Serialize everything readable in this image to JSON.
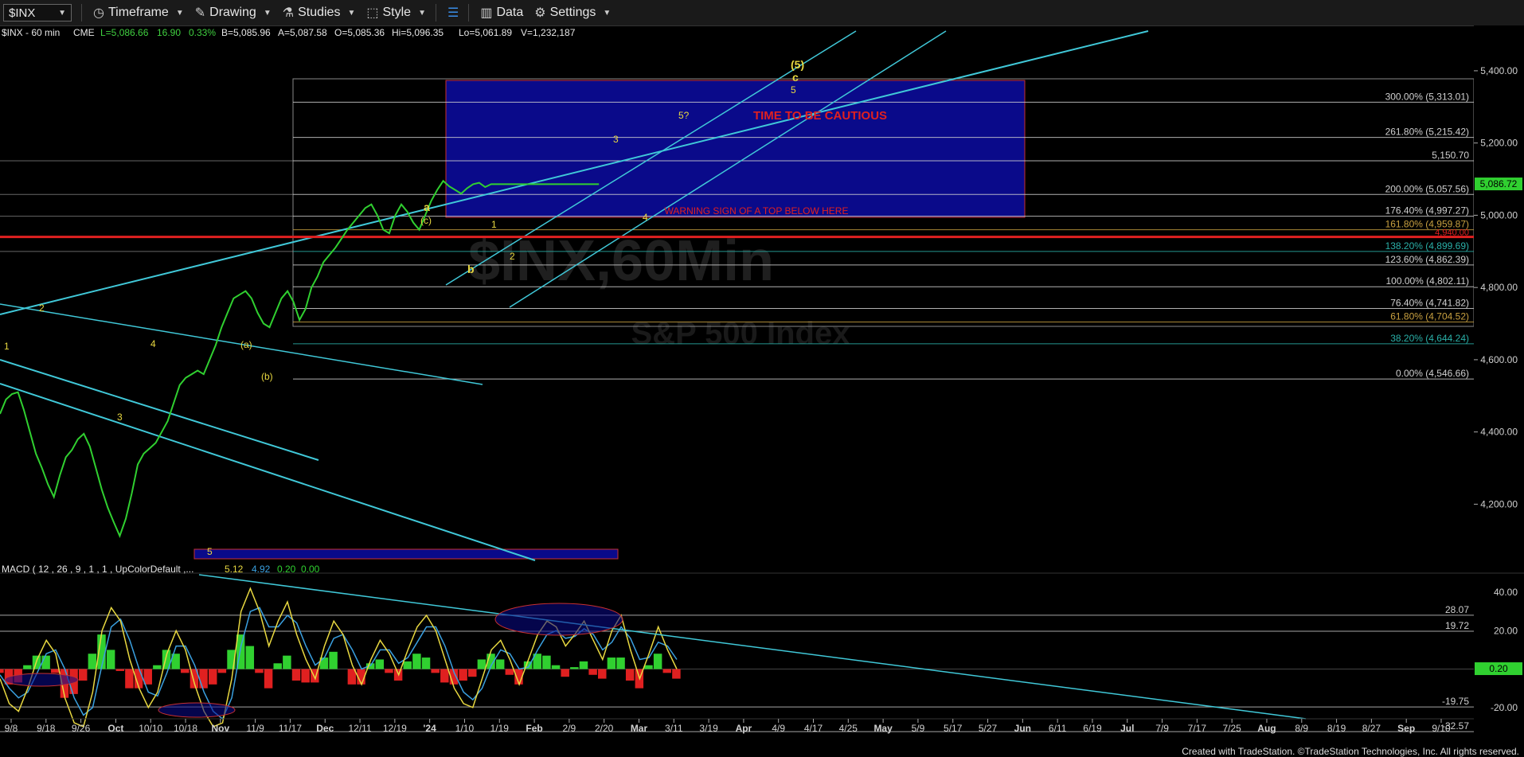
{
  "toolbar": {
    "symbol": "$INX",
    "items": [
      {
        "label": "Timeframe",
        "icon": "clock-icon"
      },
      {
        "label": "Drawing",
        "icon": "pencil-icon"
      },
      {
        "label": "Studies",
        "icon": "flask-icon"
      },
      {
        "label": "Style",
        "icon": "style-icon"
      },
      {
        "label": "",
        "icon": "layout-icon"
      },
      {
        "label": "Data",
        "icon": "bars-icon"
      },
      {
        "label": "Settings",
        "icon": "gear-icon"
      }
    ]
  },
  "chart_data": {
    "type": "line",
    "header": {
      "symbol": "$INX - 60 min",
      "exchange": "CME",
      "last": "L=5,086.66",
      "change": "16.90",
      "change_pct": "0.33%",
      "bid": "B=5,085.96",
      "ask": "A=5,087.58",
      "o": "O=5,085.36",
      "hi": "Hi=5,096.35",
      "lo": "Lo=5,061.89",
      "vol": "V=1,232,187"
    },
    "watermark": {
      "symbol": "$INX,60Min",
      "name": "S&P 500 Index"
    },
    "price_axis": {
      "ylim": [
        4040,
        5510
      ],
      "ticks": [
        "4,200.00",
        "4,400.00",
        "4,600.00",
        "4,800.00",
        "5,000.00",
        "5,200.00",
        "5,400.00"
      ],
      "tick_values": [
        4200,
        4400,
        4600,
        4800,
        5000,
        5200,
        5400
      ],
      "last_label": "5,086.72",
      "last_value": 5086.72
    },
    "x_axis": {
      "ticks": [
        "9/8",
        "9/18",
        "9/26",
        "Oct",
        "10/10",
        "10/18",
        "Nov",
        "11/9",
        "11/17",
        "Dec",
        "12/11",
        "12/19",
        "'24",
        "1/10",
        "1/19",
        "Feb",
        "2/9",
        "2/20",
        "Mar",
        "3/11",
        "3/19",
        "Apr",
        "4/9",
        "4/17",
        "4/25",
        "May",
        "5/9",
        "5/17",
        "5/27",
        "Jun",
        "6/11",
        "6/19",
        "Jul",
        "7/9",
        "7/17",
        "7/25",
        "Aug",
        "8/9",
        "8/19",
        "8/27",
        "Sep",
        "9/10"
      ],
      "bold": [
        "Oct",
        "Nov",
        "Dec",
        "'24",
        "Feb",
        "Mar",
        "Apr",
        "May",
        "Jun",
        "Jul",
        "Aug",
        "Sep"
      ]
    },
    "series": [
      {
        "x": [
          0,
          3,
          6,
          9,
          12,
          15,
          18,
          21,
          24,
          27,
          30,
          33,
          36,
          39,
          42,
          45,
          48,
          51,
          54,
          57,
          60,
          63,
          66,
          69,
          72,
          75,
          78,
          81,
          84,
          87,
          90,
          93,
          96,
          99,
          102,
          105,
          108,
          111,
          114,
          117,
          120,
          123,
          126,
          129,
          132,
          135,
          138,
          141,
          144,
          147,
          150,
          153,
          156,
          159,
          162,
          165,
          168,
          171,
          174,
          177,
          180,
          183,
          186,
          189,
          192,
          195,
          198,
          201,
          204,
          207,
          210,
          213,
          216,
          219,
          222,
          225,
          228,
          231,
          234,
          237,
          240,
          243,
          246,
          249,
          252,
          255,
          258,
          261,
          264,
          267,
          270,
          273,
          276,
          279,
          282,
          285,
          288,
          291,
          294,
          297,
          300,
          303,
          306,
          309,
          312,
          315,
          318,
          321,
          324,
          327,
          330,
          333,
          336,
          339
        ],
        "values": [
          4450,
          4490,
          4505,
          4510,
          4460,
          4400,
          4340,
          4300,
          4255,
          4220,
          4280,
          4330,
          4350,
          4380,
          4395,
          4360,
          4300,
          4240,
          4190,
          4150,
          4112,
          4160,
          4230,
          4310,
          4340,
          4355,
          4370,
          4400,
          4430,
          4480,
          4530,
          4550,
          4560,
          4570,
          4560,
          4600,
          4640,
          4690,
          4730,
          4770,
          4780,
          4790,
          4770,
          4730,
          4700,
          4690,
          4730,
          4770,
          4790,
          4760,
          4710,
          4740,
          4800,
          4830,
          4870,
          4890,
          4910,
          4935,
          4960,
          4980,
          5000,
          5020,
          5030,
          5000,
          4960,
          4950,
          5000,
          5030,
          5010,
          4980,
          4960,
          5000,
          5040,
          5070,
          5095,
          5080,
          5070,
          5060,
          5075,
          5086,
          5090,
          5078,
          5086,
          5086,
          5086,
          5086,
          5086,
          5086,
          5086,
          5086,
          5086,
          5086,
          5086,
          5086,
          5086,
          5086,
          5086,
          5086,
          5086,
          5086,
          5086,
          5086,
          5086,
          5086,
          5086,
          5086,
          5086,
          5086,
          5086,
          5086,
          5086,
          5086,
          5086,
          5086
        ]
      }
    ],
    "price_levels": [
      {
        "label": "300.00% (5,313.01)",
        "value": 5313.01,
        "color": "#d0d0d0"
      },
      {
        "label": "261.80% (5,215.42)",
        "value": 5215.42,
        "color": "#d0d0d0"
      },
      {
        "label": "5,150.70",
        "value": 5150.7,
        "color": "#d0d0d0"
      },
      {
        "label": "200.00% (5,057.56)",
        "value": 5057.56,
        "color": "#d0d0d0"
      },
      {
        "label": "176.40% (4,997.27)",
        "value": 4997.27,
        "color": "#d0d0d0"
      },
      {
        "label": "161.80% (4,959.87)",
        "value": 4959.87,
        "color": "#c8a040"
      },
      {
        "label": "138.20% (4,899.69)",
        "value": 4899.69,
        "color": "#2ab0a8"
      },
      {
        "label": "123.60% (4,862.39)",
        "value": 4862.39,
        "color": "#d0d0d0"
      },
      {
        "label": "100.00% (4,802.11)",
        "value": 4802.11,
        "color": "#d0d0d0"
      },
      {
        "label": "76.40% (4,741.82)",
        "value": 4741.82,
        "color": "#d0d0d0"
      },
      {
        "label": "61.80% (4,704.52)",
        "value": 4704.52,
        "color": "#c8a040"
      },
      {
        "label": "38.20% (4,644.24)",
        "value": 4644.24,
        "color": "#2ab0a8"
      },
      {
        "label": "0.00% (4,546.66)",
        "value": 4546.66,
        "color": "#d0d0d0"
      }
    ],
    "red_line": {
      "label": "4,940.00",
      "value": 4940
    },
    "annotations": [
      {
        "text": "TIME TO BE CAUTIOUS",
        "color": "#e02020"
      },
      {
        "text": "WARNING SIGN OF A TOP BELOW HERE",
        "color": "#e02020"
      }
    ],
    "wave_labels": [
      "(5)",
      "c",
      "5",
      "5?",
      "3",
      "4",
      "a",
      "(c)",
      "1",
      "b",
      "2",
      "(a)",
      "(b)",
      "2",
      "1",
      "4",
      "3",
      "5"
    ],
    "macd": {
      "title": "MACD ( 12 , 26 , 9 , 1 , 1 , UpColorDefault ,...",
      "values": [
        "5.12",
        "4.92",
        "0.20",
        "0.00"
      ],
      "value_colors": [
        "#e8d840",
        "#3aa0e0",
        "#30d030",
        "#30d030"
      ],
      "ylim": [
        -40,
        45
      ],
      "ticks": [
        "40.00",
        "20.00",
        "-20.00"
      ],
      "tick_values": [
        40,
        20,
        -20
      ],
      "levels": [
        {
          "label": "28.07",
          "value": 28.07
        },
        {
          "label": "19.72",
          "value": 19.72
        },
        {
          "label": "-19.75",
          "value": -19.75
        },
        {
          "label": "-32.57",
          "value": -32.57
        }
      ],
      "last_label": "0.20",
      "last_value": 0.2,
      "macd_values": [
        -5,
        -18,
        -22,
        -10,
        5,
        15,
        8,
        -15,
        -28,
        -30,
        -12,
        20,
        32,
        25,
        5,
        -10,
        -20,
        -12,
        8,
        20,
        10,
        -8,
        -22,
        -30,
        -28,
        -5,
        30,
        42,
        30,
        12,
        25,
        35,
        18,
        5,
        -5,
        12,
        25,
        18,
        2,
        -8,
        5,
        15,
        8,
        -3,
        10,
        22,
        28,
        20,
        5,
        -10,
        -18,
        -20,
        -5,
        10,
        15,
        5,
        -8,
        5,
        18,
        25,
        22,
        12,
        18,
        25,
        15,
        5,
        20,
        28,
        10,
        -5,
        8,
        22,
        10,
        0
      ],
      "signal_values": [
        -3,
        -10,
        -15,
        -12,
        -2,
        8,
        10,
        0,
        -15,
        -24,
        -20,
        2,
        22,
        26,
        15,
        0,
        -12,
        -14,
        -2,
        12,
        12,
        2,
        -12,
        -22,
        -26,
        -15,
        12,
        30,
        32,
        22,
        22,
        28,
        24,
        12,
        2,
        6,
        16,
        18,
        10,
        0,
        2,
        10,
        10,
        3,
        6,
        14,
        22,
        22,
        12,
        -2,
        -12,
        -16,
        -10,
        2,
        10,
        8,
        0,
        1,
        10,
        18,
        20,
        16,
        17,
        21,
        18,
        10,
        14,
        22,
        16,
        5,
        6,
        14,
        12,
        5
      ]
    },
    "footer": "Created with TradeStation. ©TradeStation Technologies, Inc. All rights reserved."
  }
}
